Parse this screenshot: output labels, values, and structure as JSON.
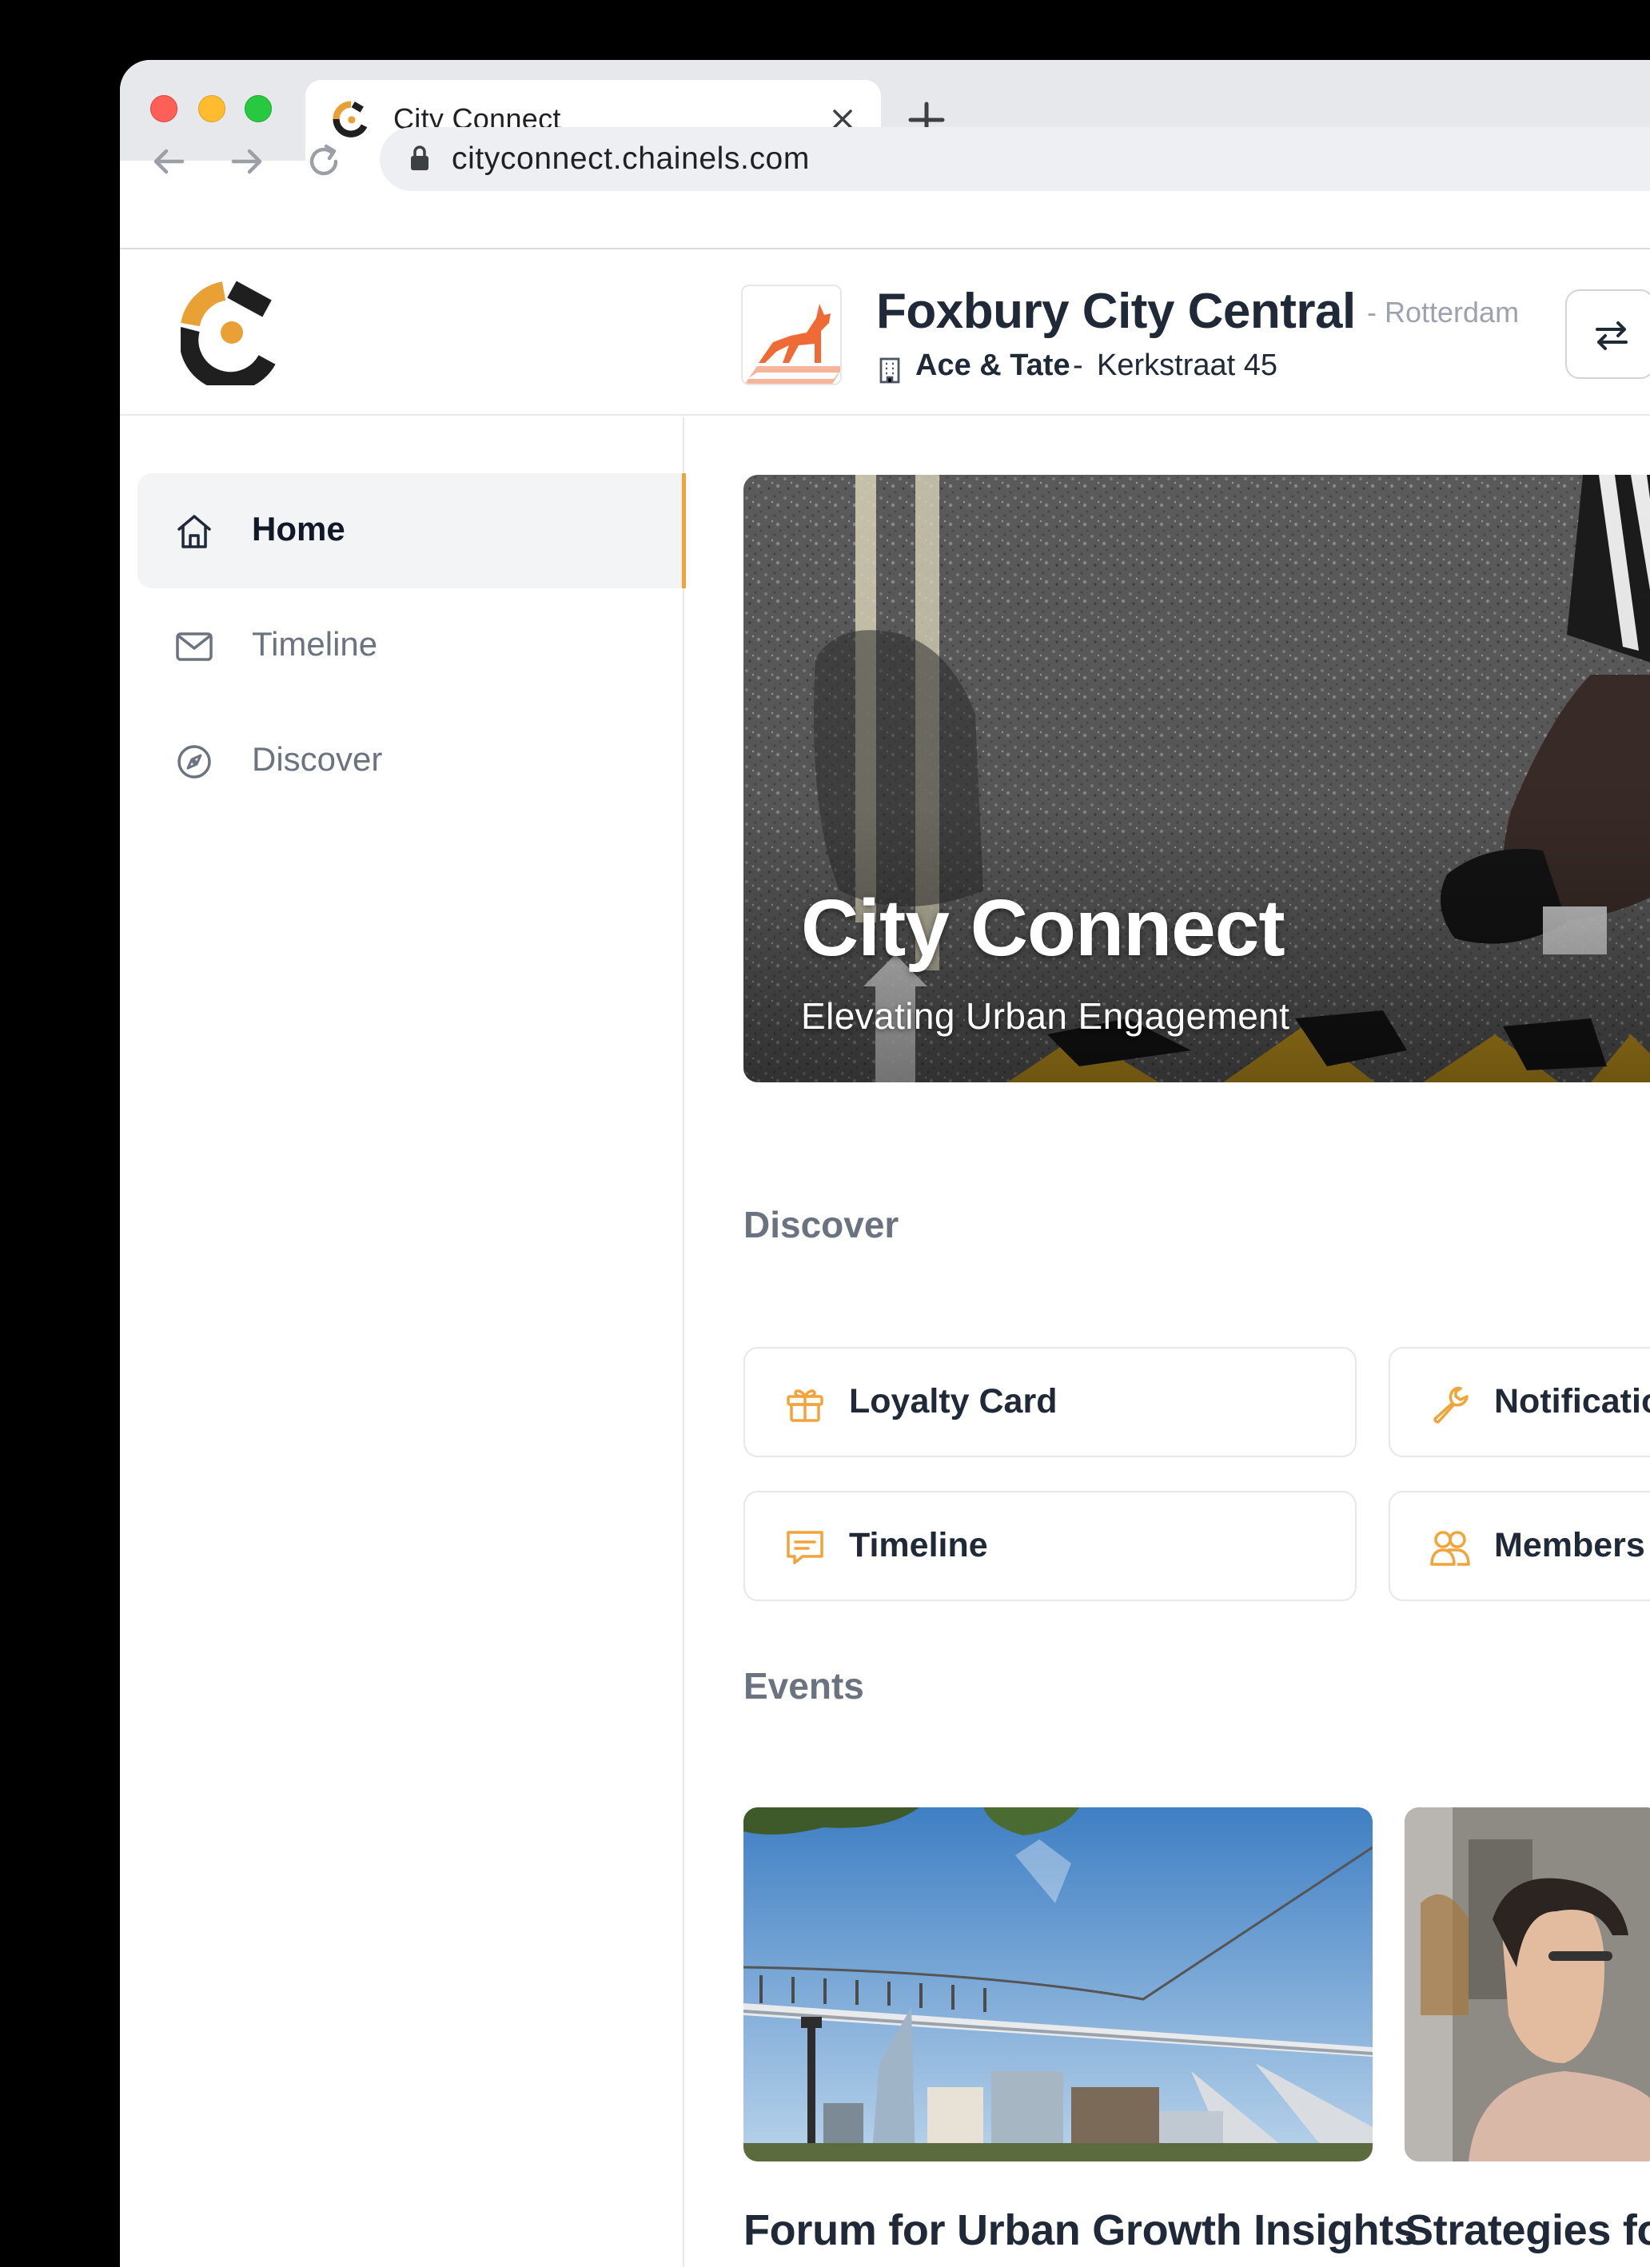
{
  "browser": {
    "tab_title": "City Connect",
    "url": "cityconnect.chainels.com"
  },
  "header": {
    "org_name": "Foxbury City Central",
    "org_city": "- Rotterdam",
    "store_name": "Ace & Tate",
    "store_separator": "-",
    "store_address": "Kerkstraat 45"
  },
  "sidebar": {
    "items": [
      {
        "label": "Home",
        "icon": "home-icon",
        "active": true
      },
      {
        "label": "Timeline",
        "icon": "mail-icon",
        "active": false
      },
      {
        "label": "Discover",
        "icon": "compass-icon",
        "active": false
      }
    ]
  },
  "hero": {
    "title": "City Connect",
    "subtitle": "Elevating Urban Engagement"
  },
  "discover": {
    "title": "Discover",
    "items": [
      {
        "label": "Loyalty Card",
        "icon": "gift-icon"
      },
      {
        "label": "Notifications",
        "icon": "wrench-icon"
      },
      {
        "label": "Timeline",
        "icon": "message-icon"
      },
      {
        "label": "Members",
        "icon": "users-icon"
      }
    ]
  },
  "events": {
    "title": "Events",
    "items": [
      {
        "title": "Forum for Urban Growth Insights"
      },
      {
        "title": "Strategies for Entrepreneurs"
      }
    ]
  },
  "colors": {
    "accent": "#f2a43a",
    "text_dark": "#1f2937",
    "text_muted": "#6b7280"
  }
}
